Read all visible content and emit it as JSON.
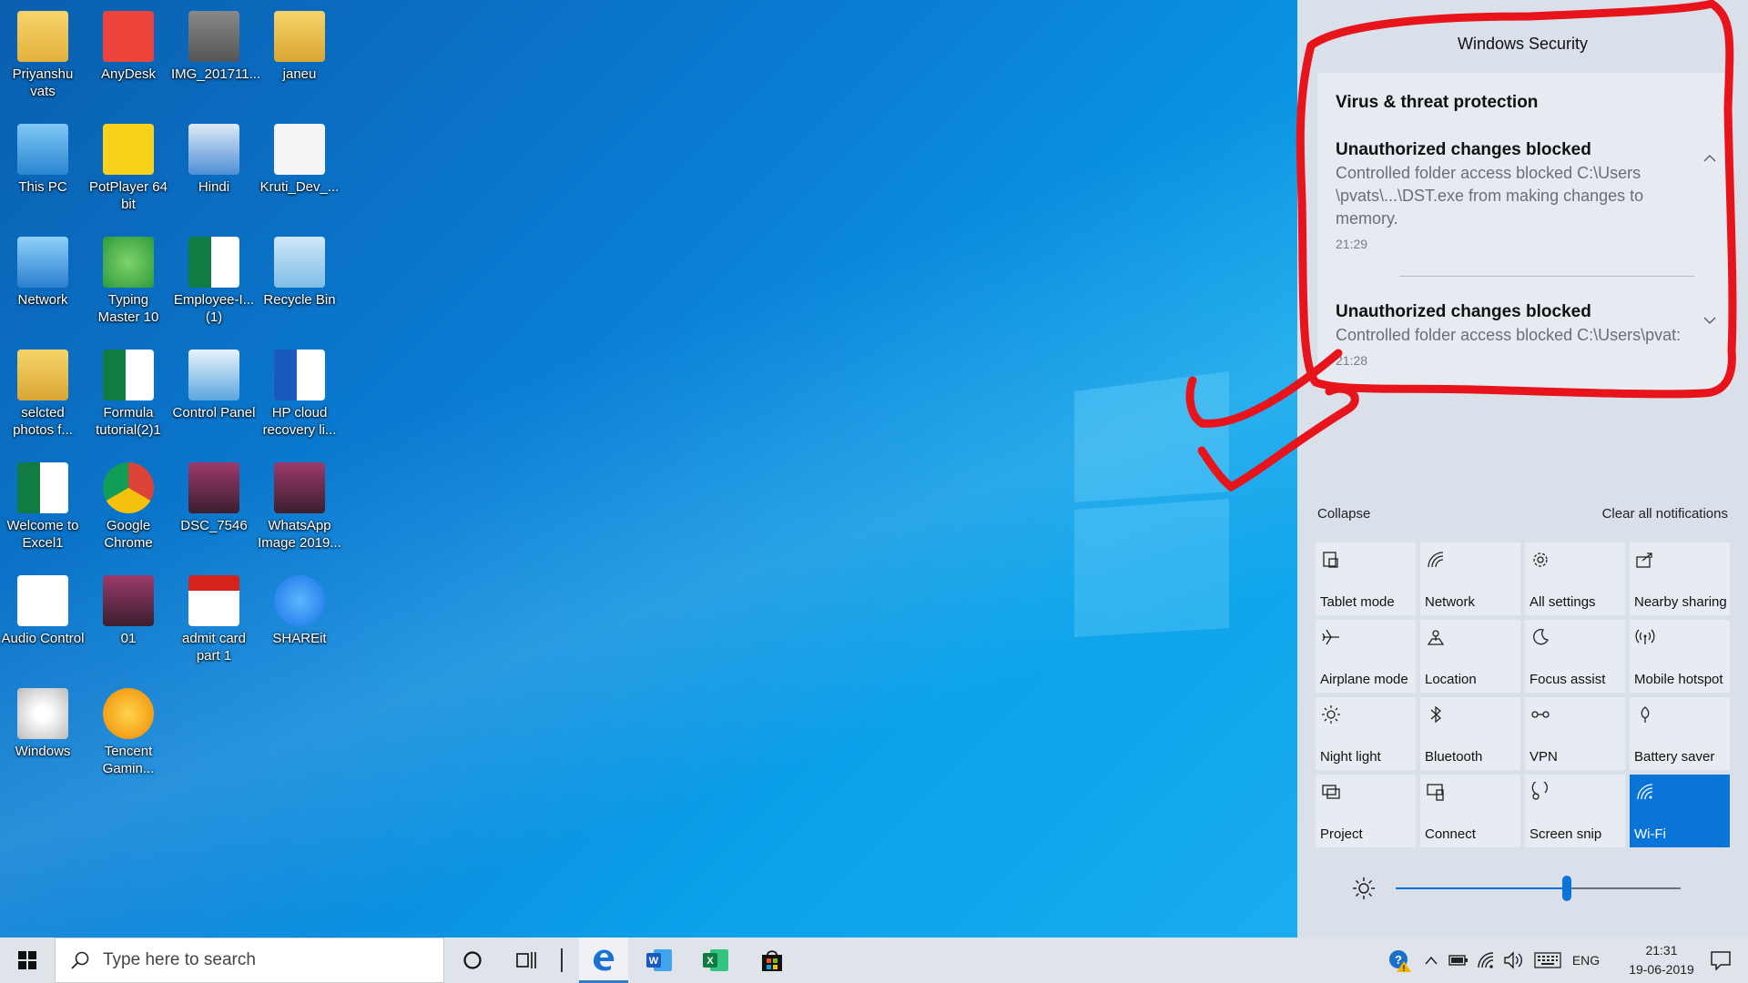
{
  "desktop": {
    "icons": [
      {
        "label": "Priyanshu vats",
        "icon": "user-folder-icon"
      },
      {
        "label": "AnyDesk",
        "icon": "anydesk-icon"
      },
      {
        "label": "IMG_201711...",
        "icon": "image-file-icon"
      },
      {
        "label": "janeu",
        "icon": "folder-icon"
      },
      {
        "label": "This PC",
        "icon": "computer-icon"
      },
      {
        "label": "PotPlayer 64 bit",
        "icon": "potplayer-icon"
      },
      {
        "label": "Hindi",
        "icon": "installer-icon"
      },
      {
        "label": "Kruti_Dev_...",
        "icon": "font-file-icon"
      },
      {
        "label": "Network",
        "icon": "network-icon"
      },
      {
        "label": "Typing Master 10",
        "icon": "typing-master-icon"
      },
      {
        "label": "Employee-I... (1)",
        "icon": "excel-file-icon"
      },
      {
        "label": "Recycle Bin",
        "icon": "recycle-bin-icon"
      },
      {
        "label": "selcted photos f...",
        "icon": "folder-icon"
      },
      {
        "label": "Formula tutorial(2)1",
        "icon": "excel-file-icon"
      },
      {
        "label": "Control Panel",
        "icon": "control-panel-icon"
      },
      {
        "label": "HP cloud recovery li...",
        "icon": "word-file-icon"
      },
      {
        "label": "Welcome to Excel1",
        "icon": "excel-file-icon"
      },
      {
        "label": "Google Chrome",
        "icon": "chrome-icon"
      },
      {
        "label": "DSC_7546",
        "icon": "photo-icon"
      },
      {
        "label": "WhatsApp Image 2019...",
        "icon": "photo-icon"
      },
      {
        "label": "Audio Control",
        "icon": "audio-control-icon"
      },
      {
        "label": "01",
        "icon": "photo-icon"
      },
      {
        "label": "admit card part 1",
        "icon": "pdf-icon"
      },
      {
        "label": "SHAREit",
        "icon": "shareit-icon"
      },
      {
        "label": "Windows",
        "icon": "disc-icon"
      },
      {
        "label": "Tencent Gamin...",
        "icon": "tencent-icon"
      }
    ]
  },
  "action_center": {
    "title": "Windows Security",
    "card": {
      "app": "Virus & threat protection",
      "notifications": [
        {
          "title": "Unauthorized changes blocked",
          "body": [
            "Controlled folder access blocked C:\\Users",
            "\\pvats\\...\\DST.exe from making changes to",
            "memory."
          ],
          "time": "21:29"
        },
        {
          "title": "Unauthorized changes blocked",
          "body": [
            "Controlled folder access blocked C:\\Users\\pvat:"
          ],
          "time": "21:28"
        }
      ]
    },
    "collapse": "Collapse",
    "clear_all": "Clear all notifications",
    "quick_actions": [
      {
        "label": "Tablet mode",
        "icon": "tablet-mode-icon",
        "on": false
      },
      {
        "label": "Network",
        "icon": "network-signal-icon",
        "on": false
      },
      {
        "label": "All settings",
        "icon": "gear-icon",
        "on": false
      },
      {
        "label": "Nearby sharing",
        "icon": "share-icon",
        "on": false
      },
      {
        "label": "Airplane mode",
        "icon": "airplane-icon",
        "on": false
      },
      {
        "label": "Location",
        "icon": "location-icon",
        "on": false
      },
      {
        "label": "Focus assist",
        "icon": "moon-icon",
        "on": false
      },
      {
        "label": "Mobile hotspot",
        "icon": "hotspot-icon",
        "on": false
      },
      {
        "label": "Night light",
        "icon": "sun-icon",
        "on": false
      },
      {
        "label": "Bluetooth",
        "icon": "bluetooth-icon",
        "on": false
      },
      {
        "label": "VPN",
        "icon": "vpn-icon",
        "on": false
      },
      {
        "label": "Battery saver",
        "icon": "battery-saver-icon",
        "on": false
      },
      {
        "label": "Project",
        "icon": "project-icon",
        "on": false
      },
      {
        "label": "Connect",
        "icon": "connect-icon",
        "on": false
      },
      {
        "label": "Screen snip",
        "icon": "scissors-icon",
        "on": false
      },
      {
        "label": "Wi-Fi",
        "icon": "wifi-icon",
        "on": true
      }
    ],
    "brightness": 0.6
  },
  "taskbar": {
    "search_placeholder": "Type here to search",
    "language": "ENG",
    "time": "21:31",
    "date": "19-06-2019"
  },
  "colors": {
    "accent": "#0a74d8",
    "annotation": "#e8141b"
  }
}
